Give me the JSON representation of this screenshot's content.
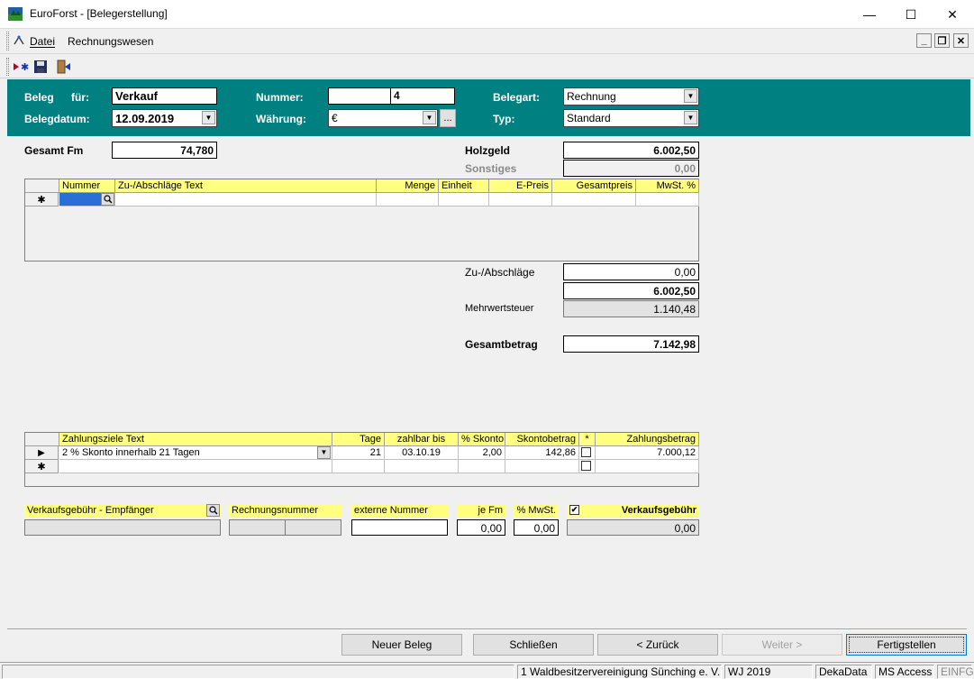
{
  "window": {
    "title": "EuroForst - [Belegerstellung]",
    "minimize": "—",
    "maximize": "☐",
    "close": "✕"
  },
  "menu": {
    "items": [
      "Datei",
      "Rechnungswesen"
    ]
  },
  "header": {
    "beleg_label": "Beleg",
    "fuer_label": "für:",
    "beleg_value": "Verkauf",
    "belegdatum_label": "Belegdatum:",
    "belegdatum_value": "12.09.2019",
    "nummer_label": "Nummer:",
    "nummer_value": "4",
    "waehrung_label": "Währung:",
    "waehrung_value": "€",
    "waehrung_browse": "...",
    "belegart_label": "Belegart:",
    "belegart_value": "Rechnung",
    "typ_label": "Typ:",
    "typ_value": "Standard"
  },
  "totals": {
    "gesamt_fm_label": "Gesamt  Fm",
    "gesamt_fm_value": "74,780",
    "holzgeld_label": "Holzgeld",
    "holzgeld_value": "6.002,50",
    "sonstiges_label": "Sonstiges",
    "sonstiges_value": "0,00",
    "zuabschlaege_label": "Zu-/Abschläge",
    "zuabschlaege_value": "0,00",
    "zwischensumme_value": "6.002,50",
    "mwst_label": "Mehrwertsteuer",
    "mwst_value": "1.140,48",
    "gesamtbetrag_label": "Gesamtbetrag",
    "gesamtbetrag_value": "7.142,98"
  },
  "zu_grid": {
    "columns": [
      "Nummer",
      "Zu-/Abschläge Text",
      "Menge",
      "Einheit",
      "E-Preis",
      "Gesamtpreis",
      "MwSt. %"
    ],
    "new_row_marker": "✱"
  },
  "zahlung_grid": {
    "columns": [
      "Zahlungsziele Text",
      "Tage",
      "zahlbar bis",
      "% Skonto",
      "Skontobetrag",
      "*",
      "Zahlungsbetrag"
    ],
    "rows": [
      {
        "marker": "▶",
        "text": "2 % Skonto innerhalb 21 Tagen",
        "tage": "21",
        "zahlbar_bis": "03.10.19",
        "skonto": "2,00",
        "skontobetrag": "142,86",
        "zahlungsbetrag": "7.000,12"
      }
    ],
    "new_row_marker": "✱"
  },
  "gebuehr": {
    "empfaenger_label": "Verkaufsgebühr - Empfänger",
    "rechnungsnummer_label": "Rechnungsnummer",
    "externe_nummer_label": "externe Nummer",
    "je_fm_label": "je Fm",
    "je_fm_value": "0,00",
    "mwst_label": "% MwSt.",
    "mwst_value": "0,00",
    "verkaufsgebuehr_label": "Verkaufsgebühr",
    "verkaufsgebuehr_value": "0,00",
    "verkaufsgebuehr_checked": "✔"
  },
  "buttons": {
    "neuer_beleg": "Neuer Beleg",
    "schliessen": "Schließen",
    "zurueck": "< Zurück",
    "weiter": "Weiter >",
    "fertigstellen": "Fertigstellen"
  },
  "statusbar": {
    "org": "1 Waldbesitzervereinigung Sünching e. V.",
    "wj": "WJ 2019",
    "db": "DekaData",
    "access": "MS Access",
    "mode": "EINFG"
  },
  "colors": {
    "header_bg": "#008080",
    "grid_header": "#ffff80"
  }
}
